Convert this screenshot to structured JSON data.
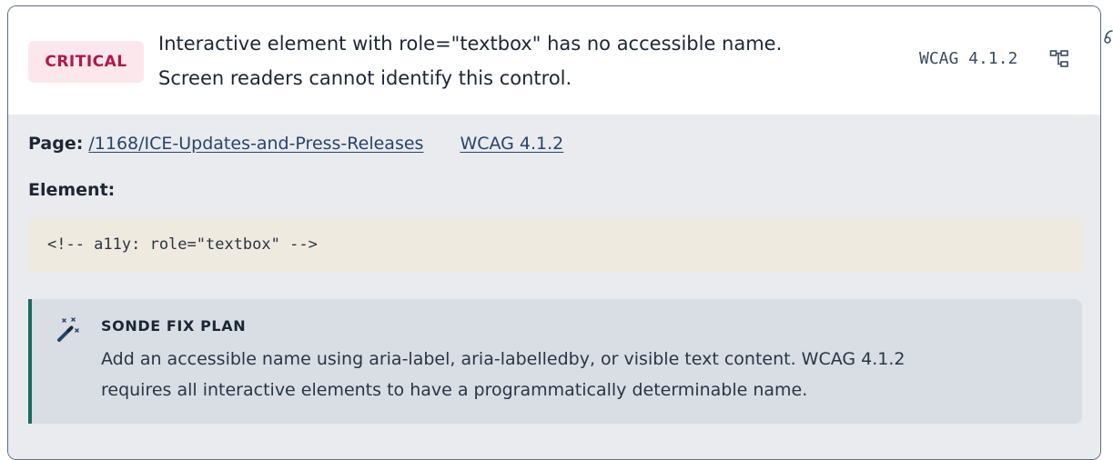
{
  "issue": {
    "severity": "CRITICAL",
    "message_lines": [
      "Interactive element with role=\"textbox\" has no accessible name.",
      "Screen readers cannot identify this control."
    ],
    "wcag_tag": "WCAG 4.1.2",
    "severity_color": "#b3164a"
  },
  "details": {
    "page_label": "Page:",
    "page_link": "/1168/ICE-Updates-and-Press-Releases",
    "wcag_link": "WCAG 4.1.2",
    "element_label": "Element:",
    "element_code": "<!-- a11y: role=\"textbox\" -->"
  },
  "fix_plan": {
    "title": "SONDE FIX PLAN",
    "text_lines": [
      "Add an accessible name using aria-label, aria-labelledby, or visible text content. WCAG 4.1.2",
      "requires all interactive elements to have a programmatically determinable name."
    ],
    "icon": "magic-wand-icon",
    "accent_color": "#1d6b5e"
  }
}
